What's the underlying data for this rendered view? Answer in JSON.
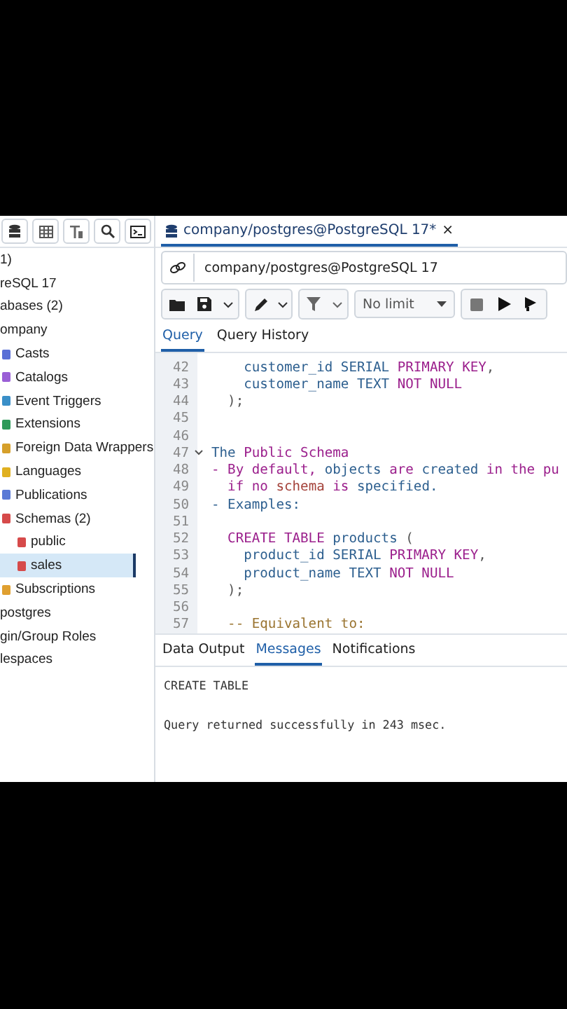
{
  "sidebar": {
    "tree": [
      {
        "label": "1)",
        "selected": false,
        "children": [
          {
            "label": "reSQL 17",
            "selected": false,
            "children": [
              {
                "label": "abases (2)",
                "selected": false,
                "children": [
                  {
                    "label": "ompany",
                    "selected": false,
                    "children": [
                      {
                        "label": "Casts",
                        "selected": false,
                        "color": "#5a6fd6"
                      },
                      {
                        "label": "Catalogs",
                        "selected": false,
                        "color": "#9a5fd6"
                      },
                      {
                        "label": "Event Triggers",
                        "selected": false,
                        "color": "#3a8fc8"
                      },
                      {
                        "label": "Extensions",
                        "selected": false,
                        "color": "#2f9a5a"
                      },
                      {
                        "label": "Foreign Data Wrappers",
                        "selected": false,
                        "color": "#d6a02a"
                      },
                      {
                        "label": "Languages",
                        "selected": false,
                        "color": "#e0b020"
                      },
                      {
                        "label": "Publications",
                        "selected": false,
                        "color": "#5a7ad6"
                      },
                      {
                        "label": "Schemas (2)",
                        "selected": false,
                        "color": "#d64a4a",
                        "children": [
                          {
                            "label": "public",
                            "selected": false,
                            "color": "#d64a4a"
                          },
                          {
                            "label": "sales",
                            "selected": true,
                            "color": "#d64a4a"
                          }
                        ]
                      },
                      {
                        "label": "Subscriptions",
                        "selected": false,
                        "color": "#e0a030"
                      }
                    ]
                  }
                ]
              },
              {
                "label": "postgres",
                "selected": false
              }
            ]
          },
          {
            "label": "gin/Group Roles",
            "selected": false
          },
          {
            "label": "lespaces",
            "selected": false
          }
        ]
      }
    ]
  },
  "tab": {
    "title": "company/postgres@PostgreSQL 17*",
    "close": "×"
  },
  "connection": "company/postgres@PostgreSQL 17",
  "toolbar": {
    "limit": "No limit"
  },
  "query_tabs": [
    {
      "label": "Query",
      "selected": true
    },
    {
      "label": "Query History",
      "selected": false
    }
  ],
  "code": [
    {
      "n": "42",
      "fold": false,
      "segments": [
        {
          "t": "    customer_id SERIAL ",
          "color": "#2d5f8f"
        },
        {
          "t": "PRIMARY KEY",
          "color": "#9b1f8c"
        },
        {
          "t": ",",
          "color": "#555555"
        }
      ]
    },
    {
      "n": "43",
      "fold": false,
      "segments": [
        {
          "t": "    customer_name TEXT ",
          "color": "#2d5f8f"
        },
        {
          "t": "NOT NULL",
          "color": "#9b1f8c"
        }
      ]
    },
    {
      "n": "44",
      "fold": false,
      "segments": [
        {
          "t": "  );",
          "color": "#555555"
        }
      ]
    },
    {
      "n": "45",
      "fold": false
    },
    {
      "n": "46",
      "fold": false
    },
    {
      "n": "47",
      "fold": true,
      "segments": [
        {
          "t": "The ",
          "color": "#2d5f8f"
        },
        {
          "t": "Public Schema",
          "color": "#9b1f8c"
        }
      ]
    },
    {
      "n": "48",
      "fold": false,
      "segments": [
        {
          "t": "- By default, ",
          "color": "#9b1f8c"
        },
        {
          "t": "objects ",
          "color": "#2d5f8f"
        },
        {
          "t": "are ",
          "color": "#9b1f8c"
        },
        {
          "t": "created ",
          "color": "#2d5f8f"
        },
        {
          "t": "in the pu",
          "color": "#9b1f8c"
        }
      ]
    },
    {
      "n": "49",
      "fold": false,
      "segments": [
        {
          "t": "  if no ",
          "color": "#9b1f8c"
        },
        {
          "t": "schema ",
          "color": "#a4423a"
        },
        {
          "t": "is ",
          "color": "#9b1f8c"
        },
        {
          "t": "specified.",
          "color": "#2d5f8f"
        }
      ]
    },
    {
      "n": "50",
      "fold": false,
      "segments": [
        {
          "t": "- Examples:",
          "color": "#2d5f8f"
        }
      ]
    },
    {
      "n": "51",
      "fold": false
    },
    {
      "n": "52",
      "fold": false,
      "segments": [
        {
          "t": "  CREATE TABLE ",
          "color": "#9b1f8c"
        },
        {
          "t": "products ",
          "color": "#2d5f8f"
        },
        {
          "t": "(",
          "color": "#555555"
        }
      ]
    },
    {
      "n": "53",
      "fold": false,
      "segments": [
        {
          "t": "    product_id SERIAL ",
          "color": "#2d5f8f"
        },
        {
          "t": "PRIMARY KEY",
          "color": "#9b1f8c"
        },
        {
          "t": ",",
          "color": "#555555"
        }
      ]
    },
    {
      "n": "54",
      "fold": false,
      "segments": [
        {
          "t": "    product_name TEXT ",
          "color": "#2d5f8f"
        },
        {
          "t": "NOT NULL",
          "color": "#9b1f8c"
        }
      ]
    },
    {
      "n": "55",
      "fold": false,
      "segments": [
        {
          "t": "  );",
          "color": "#555555"
        }
      ]
    },
    {
      "n": "56",
      "fold": false
    },
    {
      "n": "57",
      "fold": false,
      "segments": [
        {
          "t": "  -- Equivalent to:",
          "color": "#9a7430"
        }
      ]
    }
  ],
  "output_tabs": [
    {
      "label": "Data Output",
      "selected": false
    },
    {
      "label": "Messages",
      "selected": true
    },
    {
      "label": "Notifications",
      "selected": false
    }
  ],
  "messages": [
    "CREATE TABLE",
    "Query returned successfully in 243 msec."
  ]
}
